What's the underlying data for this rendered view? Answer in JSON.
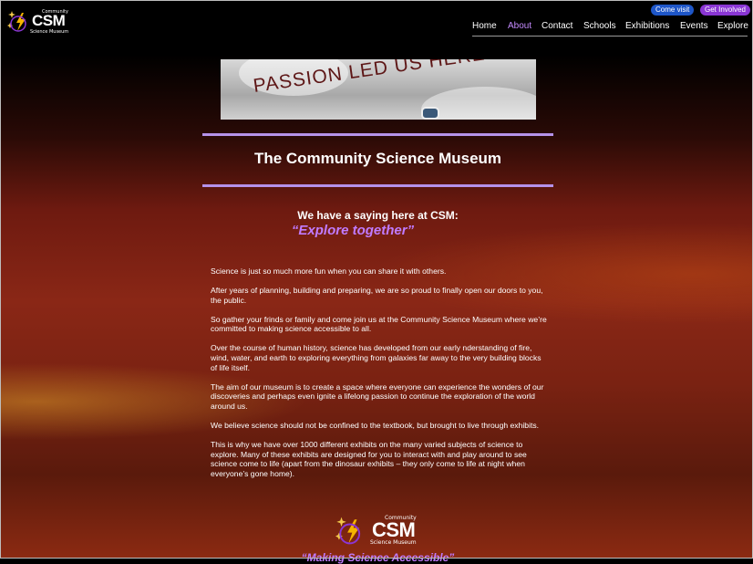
{
  "header": {
    "logo": {
      "community": "Community",
      "csm": "CSM",
      "subtitle": "Science Museum"
    },
    "come_visit": "Come visit",
    "get_involved": "Get Involved",
    "nav": [
      "Home",
      "About",
      "Contact",
      "Schools",
      "Exhibitions",
      "Events",
      "Explore"
    ],
    "active_nav": "About"
  },
  "banner": {
    "text": "PASSION LED US HERE"
  },
  "main": {
    "title": "The Community Science Museum",
    "saying_intro": "We have a saying here at CSM:",
    "saying_quote": "“Explore together”",
    "paragraphs": [
      "Science is just so much more fun when you can share it with others.",
      "After years of planning, building and preparing, we are so proud to finally open our doors to you, the public.",
      "So gather your frinds or family and come join us at the Community Science Museum where we’re committed to making science accessible to all.",
      "Over the course of human history, science has developed from our early nderstanding of fire, wind, water, and earth to exploring everything from galaxies far away to the very building blocks of life itself.",
      "The aim of our museum is to create a space where everyone can experience the wonders of our discoveries and perhaps even ignite a lifelong passion to continue the exploration of the world around us.",
      "We believe science should not be confined to the textbook, but brought to live through exhibits.",
      "This is why we have over 1000 different exhibits on the many varied subjects of science to explore. Many of these exhibits are designed for you to interact with and play around to see science come to life (apart from the dinosaur exhibits – they only come to life at night when everyone’s gone home)."
    ]
  },
  "footer": {
    "logo": {
      "community": "Community",
      "csm": "CSM",
      "subtitle": "Science Museum"
    },
    "tagline": "“Making Science Accessible”"
  },
  "colors": {
    "accent": "#c07bff",
    "rule": "#b592ea",
    "visit_btn": "#1e56c8",
    "involved_btn": "#8a36d4"
  }
}
